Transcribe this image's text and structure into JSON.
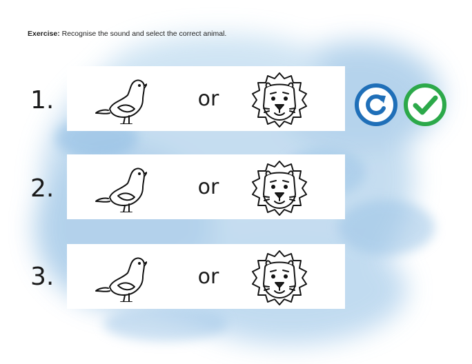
{
  "exercise": {
    "label": "Exercise:",
    "text": " Recognise the sound and select the correct animal."
  },
  "rows": [
    {
      "number": "1.",
      "option_a": "bird",
      "connector": "or",
      "option_b": "lion"
    },
    {
      "number": "2.",
      "option_a": "bird",
      "connector": "or",
      "option_b": "lion"
    },
    {
      "number": "3.",
      "option_a": "bird",
      "connector": "or",
      "option_b": "lion"
    }
  ],
  "controls": {
    "replay_icon": "replay-icon",
    "check_icon": "check-icon",
    "replay_color": "#1f6fb8",
    "check_color": "#2ca94a"
  }
}
